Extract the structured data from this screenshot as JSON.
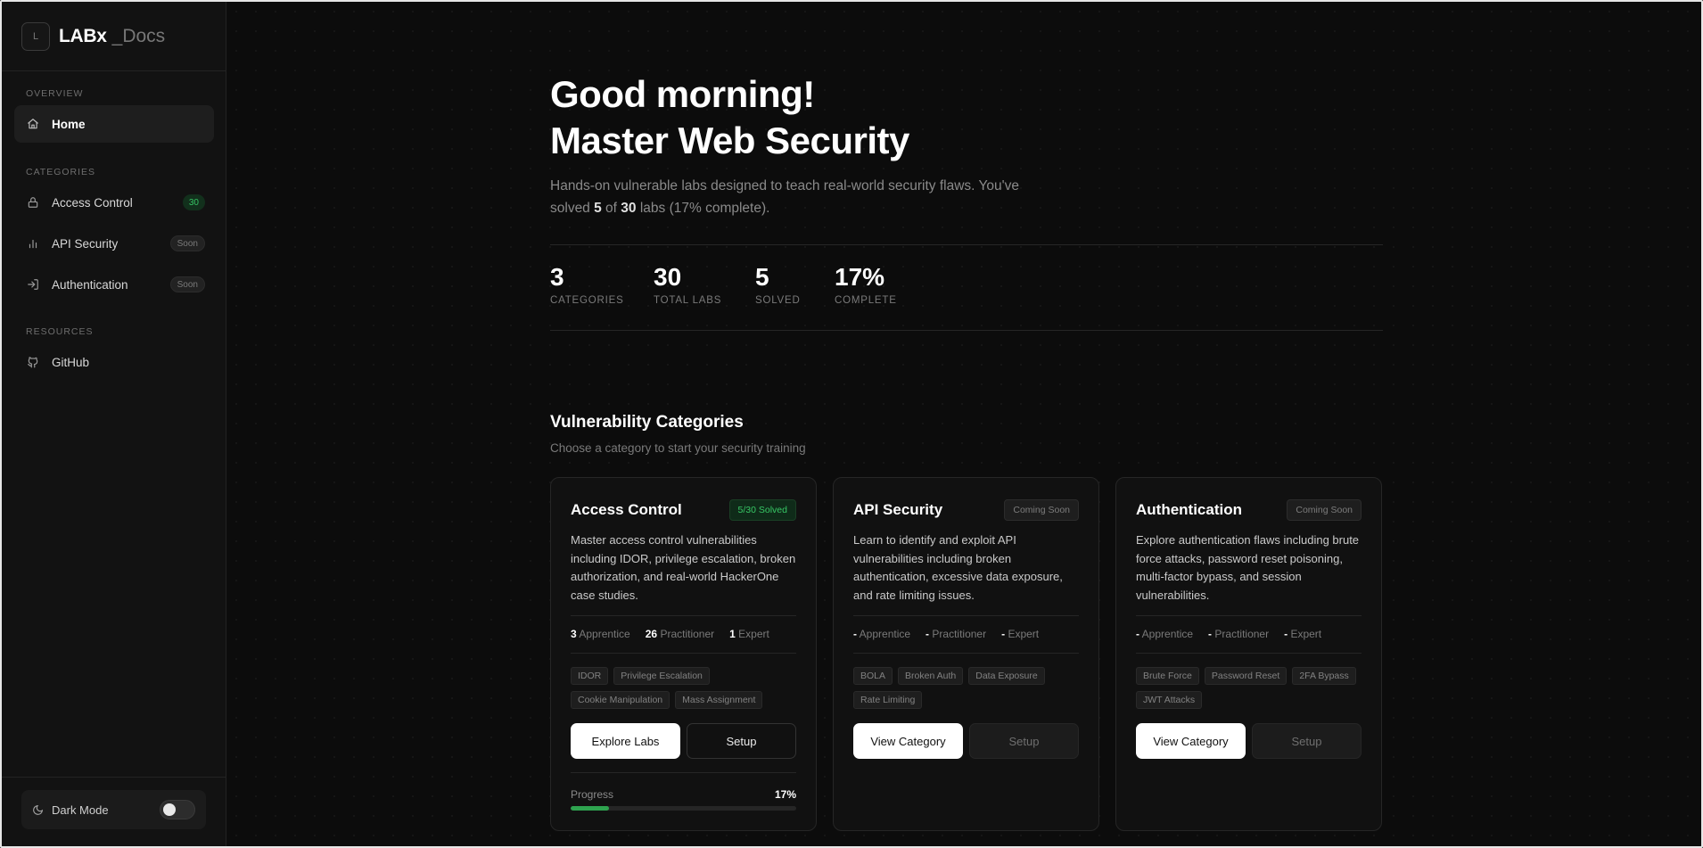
{
  "brand": {
    "logo_letter": "L",
    "name": "LABx",
    "suffix": "_Docs"
  },
  "sidebar": {
    "sections": [
      {
        "label": "OVERVIEW"
      },
      {
        "label": "CATEGORIES"
      },
      {
        "label": "RESOURCES"
      }
    ],
    "items": [
      {
        "label": "Home",
        "icon": "home-icon",
        "active": true
      },
      {
        "label": "Access Control",
        "icon": "lock-icon",
        "badge": "30"
      },
      {
        "label": "API Security",
        "icon": "bar-chart-icon",
        "badge": "Soon"
      },
      {
        "label": "Authentication",
        "icon": "login-icon",
        "badge": "Soon"
      },
      {
        "label": "GitHub",
        "icon": "github-icon"
      }
    ],
    "dark_mode_label": "Dark Mode",
    "dark_mode_on": false
  },
  "hero": {
    "greeting": "Good morning!",
    "title": "Master Web Security",
    "desc_pre": "Hands-on vulnerable labs designed to teach real-world security flaws. You've solved ",
    "solved": "5",
    "desc_mid": " of ",
    "total": "30",
    "desc_post": " labs (17% complete)."
  },
  "stats": [
    {
      "value": "3",
      "label": "CATEGORIES"
    },
    {
      "value": "30",
      "label": "TOTAL LABS"
    },
    {
      "value": "5",
      "label": "SOLVED"
    },
    {
      "value": "17%",
      "label": "COMPLETE"
    }
  ],
  "categories_section": {
    "title": "Vulnerability Categories",
    "subtitle": "Choose a category to start your security training"
  },
  "cards": [
    {
      "title": "Access Control",
      "status": "5/30 Solved",
      "desc": "Master access control vulnerabilities including IDOR, privilege escalation, broken authorization, and real-world HackerOne case studies.",
      "levels": [
        {
          "count": "3",
          "name": "Apprentice"
        },
        {
          "count": "26",
          "name": "Practitioner"
        },
        {
          "count": "1",
          "name": "Expert"
        }
      ],
      "tags": [
        "IDOR",
        "Privilege Escalation",
        "Cookie Manipulation",
        "Mass Assignment"
      ],
      "primary_label": "Explore Labs",
      "secondary_label": "Setup",
      "progress_label": "Progress",
      "progress_value": "17%",
      "progress_fraction": 0.17
    },
    {
      "title": "API Security",
      "status": "Coming Soon",
      "desc": "Learn to identify and exploit API vulnerabilities including broken authentication, excessive data exposure, and rate limiting issues.",
      "levels": [
        {
          "count": "-",
          "name": "Apprentice"
        },
        {
          "count": "-",
          "name": "Practitioner"
        },
        {
          "count": "-",
          "name": "Expert"
        }
      ],
      "tags": [
        "BOLA",
        "Broken Auth",
        "Data Exposure",
        "Rate Limiting"
      ],
      "primary_label": "View Category",
      "secondary_label": "Setup"
    },
    {
      "title": "Authentication",
      "status": "Coming Soon",
      "desc": "Explore authentication flaws including brute force attacks, password reset poisoning, multi-factor bypass, and session vulnerabilities.",
      "levels": [
        {
          "count": "-",
          "name": "Apprentice"
        },
        {
          "count": "-",
          "name": "Practitioner"
        },
        {
          "count": "-",
          "name": "Expert"
        }
      ],
      "tags": [
        "Brute Force",
        "Password Reset",
        "2FA Bypass",
        "JWT Attacks"
      ],
      "primary_label": "View Category",
      "secondary_label": "Setup"
    }
  ],
  "colors": {
    "accent_green": "#2ea34f",
    "badge_green": "#36c464",
    "background": "#0c0c0c"
  }
}
